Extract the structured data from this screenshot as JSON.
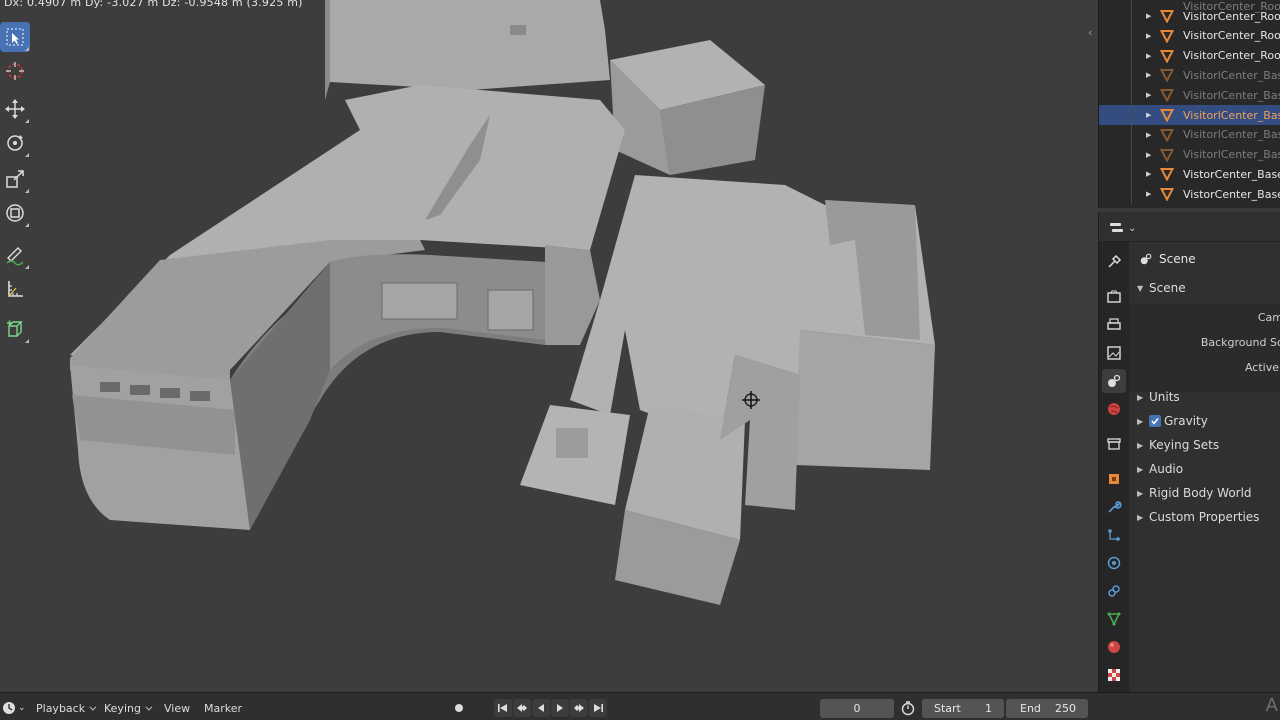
{
  "viewport": {
    "readout": "Dx: 0.4907 m  Dy: -3.027 m  Dz: -0.9548 m (3.925 m)"
  },
  "toolbar": {
    "tools": [
      {
        "name": "select-box-icon",
        "active": true
      },
      {
        "name": "cursor-icon",
        "active": false
      },
      {
        "name": "move-icon",
        "active": false
      },
      {
        "name": "rotate-icon",
        "active": false
      },
      {
        "name": "scale-icon",
        "active": false
      },
      {
        "name": "transform-icon",
        "active": false
      },
      {
        "name": "annotate-icon",
        "active": false
      },
      {
        "name": "measure-icon",
        "active": false
      },
      {
        "name": "add-cube-icon",
        "active": false
      }
    ]
  },
  "outliner": {
    "rows": [
      {
        "name": "VisitorCenter_Roofs",
        "dim": false,
        "selected": false
      },
      {
        "name": "VisitorCenter_Roofs",
        "dim": false,
        "selected": false
      },
      {
        "name": "VisitorCenter_Roofs",
        "dim": false,
        "selected": false
      },
      {
        "name": "VisitorlCenter_Base",
        "dim": true,
        "selected": false
      },
      {
        "name": "VisitorlCenter_Base",
        "dim": true,
        "selected": false
      },
      {
        "name": "VisitorlCenter_Base",
        "dim": false,
        "selected": true
      },
      {
        "name": "VisitorlCenter_Base",
        "dim": true,
        "selected": false
      },
      {
        "name": "VisitorlCenter_Base",
        "dim": true,
        "selected": false
      },
      {
        "name": "VistorCenter_Base_L",
        "dim": false,
        "selected": false
      },
      {
        "name": "VistorCenter_Base_L",
        "dim": false,
        "selected": false
      }
    ]
  },
  "properties": {
    "context_label": "Scene",
    "scene_section": "Scene",
    "fields": [
      "Cam",
      "Background Sc",
      "Active"
    ],
    "units": "Units",
    "gravity": "Gravity",
    "keying_sets": "Keying Sets",
    "audio": "Audio",
    "rigid_body": "Rigid Body World",
    "custom_props": "Custom Properties"
  },
  "timeline": {
    "playback": "Playback",
    "keying": "Keying",
    "view": "View",
    "marker": "Marker",
    "current_frame": "0",
    "start_label": "Start",
    "start_value": "1",
    "end_label": "End",
    "end_value": "250",
    "watermark": "A"
  },
  "colors": {
    "accent": "#4772b3",
    "selected_row": "#334d80",
    "mesh_orange": "#e8893a"
  }
}
